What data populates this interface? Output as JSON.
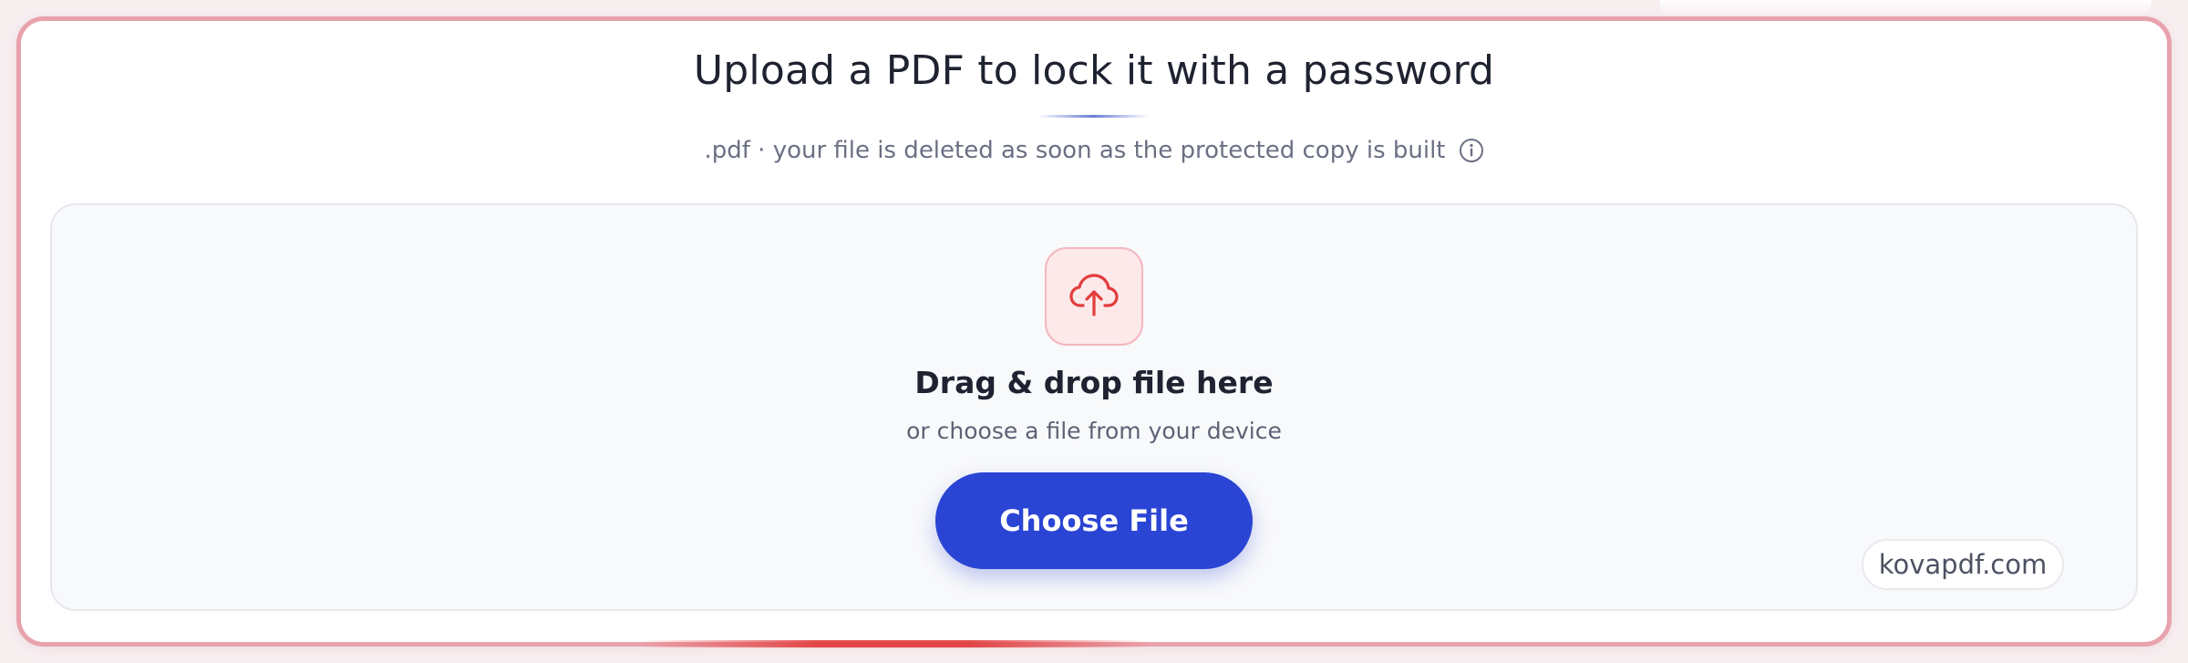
{
  "header": {
    "title": "Upload a PDF to lock it with a password",
    "subtitle": ".pdf · your file is deleted as soon as the protected copy is built",
    "info_icon": "info-circle-icon"
  },
  "dropzone": {
    "icon": "cloud-upload-icon",
    "heading": "Drag & drop file here",
    "subtext": "or choose a file from your device",
    "button_label": "Choose File"
  },
  "watermark": {
    "text": "kovapdf.com"
  },
  "colors": {
    "frame_border": "#e8a2ac",
    "accent_red": "#e23c3c",
    "primary_blue": "#2a44d4",
    "icon_tile_bg": "#fde8ea",
    "text_dark": "#1f2230",
    "text_muted": "#6b7083"
  }
}
